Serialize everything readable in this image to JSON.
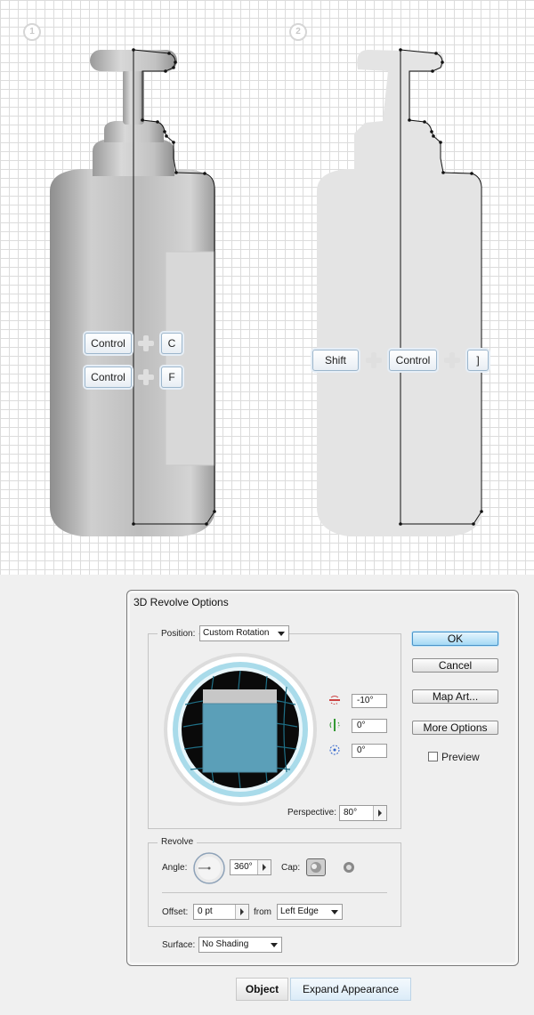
{
  "illustration": {
    "step1": "1",
    "step2": "2",
    "shortcut_copy": {
      "key1": "Control",
      "key2": "C"
    },
    "shortcut_front": {
      "key1": "Control",
      "key2": "F"
    },
    "shortcut_back": {
      "key1": "Shift",
      "key2": "Control",
      "key3": "]"
    }
  },
  "dialog": {
    "title": "3D Revolve Options",
    "position_label": "Position:",
    "position_value": "Custom Rotation",
    "rot_x": "-10°",
    "rot_y": "0°",
    "rot_z": "0°",
    "perspective_label": "Perspective:",
    "perspective_value": "80°",
    "ok_label": "OK",
    "cancel_label": "Cancel",
    "map_art_label": "Map Art...",
    "more_options_label": "More Options",
    "preview_label": "Preview",
    "preview_checked": false,
    "revolve_label": "Revolve",
    "angle_label": "Angle:",
    "angle_value": "360°",
    "cap_label": "Cap:",
    "offset_label": "Offset:",
    "offset_value": "0 pt",
    "from_label": "from",
    "from_value": "Left Edge",
    "surface_label": "Surface:",
    "surface_value": "No Shading"
  },
  "appearance_bar": {
    "object_label": "Object",
    "expand_label": "Expand Appearance"
  },
  "colors": {
    "cube_face": "#5b9fb8",
    "primary_button": "#a5d9f5"
  }
}
